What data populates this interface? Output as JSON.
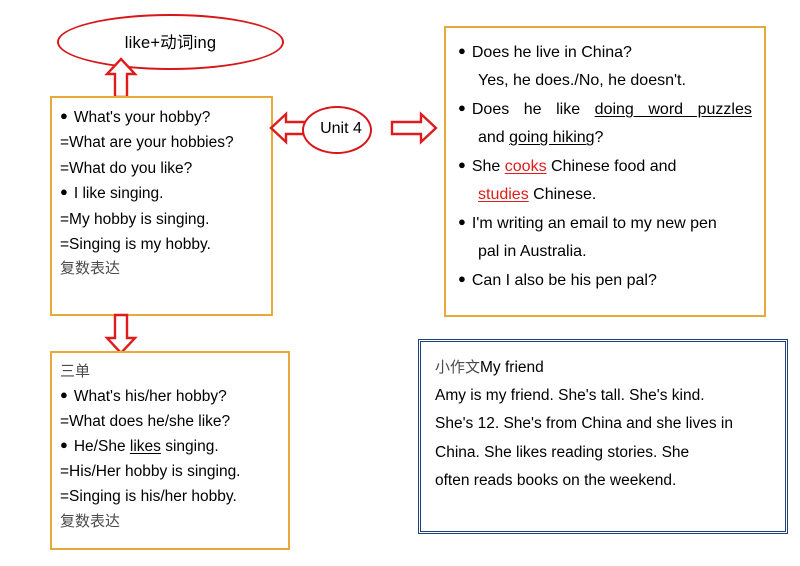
{
  "page": {
    "title": "Unit 4 hobbies grammar summary",
    "colors": {
      "orange_border": "#e8a93b",
      "blue_border": "#1f3f76",
      "red_accent": "#d8161a",
      "text": "#000000",
      "chinese_text": "#4b4b4b"
    }
  },
  "ellipse_topic": {
    "label": "like+动词ing"
  },
  "ellipse_unit": {
    "label": "Unit 4"
  },
  "arrows": {
    "up_to_topic": "arrow-up",
    "down_to_third_person": "arrow-down",
    "left_to_first_person_box": "arrow-left",
    "right_to_sentences_box": "arrow-right"
  },
  "box_left_top": {
    "lines": [
      {
        "bullet": "●",
        "text": "What's your hobby?"
      },
      {
        "bullet": "",
        "text": "=What are your hobbies?"
      },
      {
        "bullet": "",
        "text": "=What do you like?"
      },
      {
        "bullet": "●",
        "text": "I like singing."
      },
      {
        "bullet": "",
        "text": "=My hobby is singing."
      },
      {
        "bullet": "",
        "text": "=Singing is my hobby."
      }
    ],
    "note": "复数表达"
  },
  "box_left_bottom": {
    "heading": "三单",
    "lines": [
      {
        "bullet": "●",
        "pre": "",
        "underline": "",
        "post": "What's his/her hobby?"
      },
      {
        "bullet": "",
        "pre": "=What does he/she like?",
        "underline": "",
        "post": ""
      },
      {
        "bullet": "●",
        "pre": "He/She ",
        "underline": "likes",
        "post": " singing."
      },
      {
        "bullet": "",
        "pre": "=His/Her hobby is singing.",
        "underline": "",
        "post": ""
      },
      {
        "bullet": "",
        "pre": "=Singing is his/her hobby.",
        "underline": "",
        "post": ""
      }
    ],
    "note": "复数表达"
  },
  "box_right_top": {
    "items": [
      {
        "bullet": "●",
        "line1": "Does he live in China?",
        "line2": "Yes, he does./No, he doesn't.",
        "line1_style": "plain",
        "line2_style": "indent"
      },
      {
        "bullet": "●",
        "q_prefix": "Does he like ",
        "q_underline_1": "doing word puzzles",
        "q_and": "and ",
        "q_underline_2": "going hiking",
        "q_suffix": "?"
      },
      {
        "bullet": "●",
        "s_prefix": "She ",
        "s_red_1": "cooks",
        "s_mid": " Chinese food and",
        "s_red_2": "studies",
        "s_suffix": " Chinese."
      },
      {
        "bullet": "●",
        "line1": "I'm writing an email to my new pen",
        "line2": "pal in Australia."
      },
      {
        "bullet": "●",
        "line1": "Can I also be his pen pal?"
      }
    ]
  },
  "box_right_bottom": {
    "heading_cn": "小作文",
    "heading_en": "My friend",
    "paragraph_lines": [
      "Amy is my friend. She's tall. She's kind.",
      "She's 12. She's from China and she lives in",
      "China. She likes reading stories. She",
      "often reads books on the weekend."
    ]
  }
}
